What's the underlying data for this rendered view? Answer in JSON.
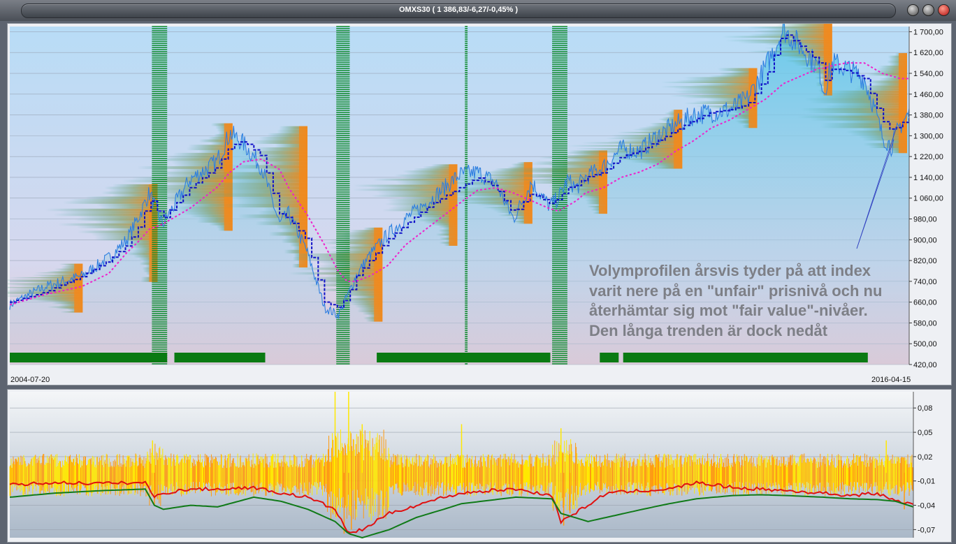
{
  "window": {
    "title": "OMXS30 ( 1 386,83/-6,27/-0,45% )"
  },
  "colors": {
    "price_line": "#2f7fe0",
    "step_line": "#1010c8",
    "moving_average": "#ee22cc",
    "volume_profile": "#f08a1e",
    "highlight_band": "#0a8a2a",
    "vol_yellow": "#ffe800",
    "vol_orange": "#ff9a10",
    "vol_red": "#e01010",
    "vol_green": "#107a18"
  },
  "annotation": {
    "text": "Volymprofilen årsvis tyder på att index varit nere på en \"unfair\" prisnivå och nu återhämtar sig mot \"fair value\"-nivåer. Den långa trenden är dock nedåt"
  },
  "chart_data": [
    {
      "type": "line",
      "name": "price-chart",
      "x_start_label": "2004-07-20",
      "x_end_label": "2016-04-15",
      "ylim": [
        420,
        1720
      ],
      "yticks": [
        420,
        500,
        580,
        660,
        740,
        820,
        900,
        980,
        1060,
        1140,
        1220,
        1300,
        1380,
        1460,
        1540,
        1620,
        1700
      ],
      "ytick_labels": [
        "420,00",
        "500,00",
        "580,00",
        "660,00",
        "740,00",
        "820,00",
        "900,00",
        "980,00",
        "1 060,00",
        "1 140,00",
        "1 220,00",
        "1 300,00",
        "1 380,00",
        "1 460,00",
        "1 540,00",
        "1 620,00",
        "1 700,00"
      ],
      "x": [
        0,
        0.04,
        0.08,
        0.11,
        0.13,
        0.145,
        0.155,
        0.17,
        0.2,
        0.23,
        0.245,
        0.26,
        0.28,
        0.3,
        0.31,
        0.33,
        0.35,
        0.365,
        0.375,
        0.385,
        0.4,
        0.42,
        0.44,
        0.47,
        0.5,
        0.52,
        0.54,
        0.56,
        0.58,
        0.6,
        0.61,
        0.62,
        0.63,
        0.64,
        0.66,
        0.68,
        0.7,
        0.72,
        0.74,
        0.76,
        0.78,
        0.8,
        0.82,
        0.84,
        0.86,
        0.88,
        0.9,
        0.905,
        0.915,
        0.93,
        0.95,
        0.96,
        0.97,
        0.98,
        0.99,
        1.0
      ],
      "series": [
        {
          "values": [
            650,
            720,
            760,
            830,
            900,
            1000,
            1080,
            960,
            1130,
            1200,
            1310,
            1270,
            1180,
            960,
            1000,
            860,
            640,
            610,
            680,
            760,
            840,
            920,
            980,
            1060,
            1150,
            1160,
            1120,
            980,
            1120,
            1030,
            1060,
            1130,
            1100,
            1140,
            1180,
            1250,
            1240,
            1300,
            1340,
            1380,
            1390,
            1400,
            1440,
            1560,
            1710,
            1640,
            1560,
            1470,
            1580,
            1560,
            1520,
            1420,
            1300,
            1260,
            1340,
            1386
          ]
        },
        {
          "values": [
            660,
            700,
            760,
            820,
            880,
            960,
            1060,
            980,
            1100,
            1180,
            1260,
            1280,
            1220,
            1000,
            980,
            900,
            660,
            640,
            680,
            760,
            820,
            900,
            960,
            1040,
            1100,
            1140,
            1100,
            1000,
            1080,
            1040,
            1060,
            1100,
            1110,
            1140,
            1160,
            1220,
            1240,
            1280,
            1320,
            1360,
            1390,
            1400,
            1420,
            1520,
            1700,
            1640,
            1580,
            1500,
            1560,
            1550,
            1520,
            1440,
            1360,
            1320,
            1340,
            1380
          ]
        },
        {
          "values": [
            650,
            690,
            720,
            770,
            850,
            900,
            940,
            960,
            1020,
            1100,
            1160,
            1200,
            1210,
            1170,
            1100,
            1000,
            880,
            780,
            740,
            740,
            760,
            800,
            880,
            960,
            1040,
            1090,
            1100,
            1080,
            1050,
            1020,
            1010,
            1030,
            1050,
            1080,
            1100,
            1140,
            1160,
            1190,
            1240,
            1280,
            1330,
            1360,
            1400,
            1440,
            1500,
            1530,
            1560,
            1560,
            1570,
            1580,
            1580,
            1560,
            1540,
            1530,
            1520,
            1520
          ]
        }
      ]
    },
    {
      "type": "line",
      "name": "volatility-chart",
      "ylim": [
        -0.08,
        0.1
      ],
      "yticks": [
        -0.07,
        -0.04,
        -0.01,
        0.02,
        0.05,
        0.08
      ],
      "ytick_labels": [
        "-0,07",
        "-0,04",
        "-0,01",
        "0,02",
        "0,05",
        "0,08"
      ],
      "x": [
        0,
        0.05,
        0.1,
        0.15,
        0.16,
        0.17,
        0.2,
        0.23,
        0.27,
        0.3,
        0.33,
        0.36,
        0.375,
        0.39,
        0.42,
        0.45,
        0.48,
        0.5,
        0.53,
        0.56,
        0.6,
        0.61,
        0.64,
        0.66,
        0.7,
        0.73,
        0.76,
        0.8,
        0.83,
        0.86,
        0.9,
        0.93,
        0.96,
        0.98,
        1.0
      ],
      "series": [
        {
          "name": "red",
          "values": [
            -0.015,
            -0.012,
            -0.013,
            -0.012,
            -0.03,
            -0.025,
            -0.02,
            -0.02,
            -0.018,
            -0.025,
            -0.03,
            -0.045,
            -0.075,
            -0.07,
            -0.05,
            -0.04,
            -0.03,
            -0.025,
            -0.022,
            -0.02,
            -0.028,
            -0.06,
            -0.04,
            -0.025,
            -0.022,
            -0.02,
            -0.012,
            -0.018,
            -0.02,
            -0.022,
            -0.025,
            -0.028,
            -0.025,
            -0.035,
            -0.038
          ]
        },
        {
          "name": "green",
          "values": [
            -0.03,
            -0.025,
            -0.022,
            -0.02,
            -0.04,
            -0.045,
            -0.04,
            -0.042,
            -0.03,
            -0.035,
            -0.045,
            -0.06,
            -0.075,
            -0.08,
            -0.07,
            -0.055,
            -0.045,
            -0.038,
            -0.034,
            -0.03,
            -0.032,
            -0.05,
            -0.06,
            -0.055,
            -0.045,
            -0.038,
            -0.032,
            -0.028,
            -0.027,
            -0.028,
            -0.03,
            -0.032,
            -0.033,
            -0.035,
            -0.042
          ]
        }
      ]
    }
  ]
}
